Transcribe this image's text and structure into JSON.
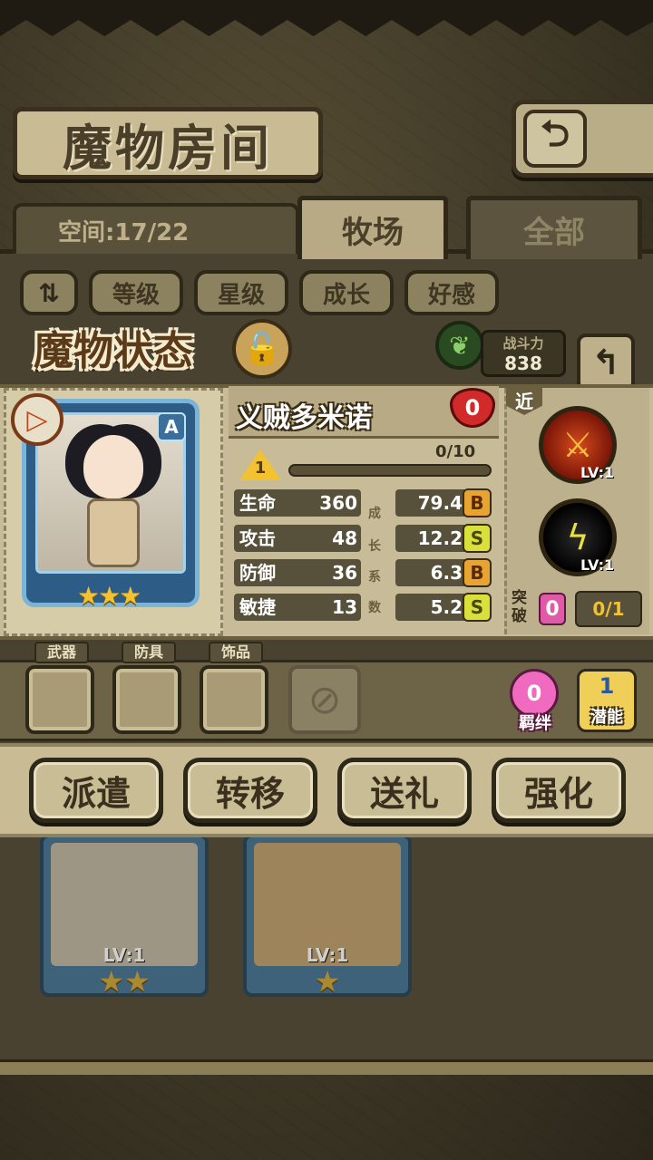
{
  "header": {
    "title": "魔物房间",
    "back_icon": "return-arrow-icon"
  },
  "room": {
    "capacity_label": "空间:17/22",
    "tabs": [
      {
        "label": "牧场",
        "active": true
      },
      {
        "label": "全部",
        "active": false
      }
    ],
    "sort_buttons": [
      "等级",
      "星级",
      "成长",
      "好感"
    ]
  },
  "status": {
    "title": "魔物状态",
    "power_label": "战斗力",
    "power_value": "838"
  },
  "monster": {
    "name": "义贼多米诺",
    "affection": "0",
    "rank": "A",
    "type_symbol": "▷",
    "stars": "★★★",
    "level": "1",
    "exp_text": "0/10",
    "exp_fraction": 0.0,
    "growth_caption": [
      "成",
      "长",
      "系",
      "数"
    ],
    "stats": [
      {
        "label": "生命",
        "value": "360",
        "growth": "79.4",
        "grade": "B"
      },
      {
        "label": "攻击",
        "value": "48",
        "growth": "12.2",
        "grade": "S"
      },
      {
        "label": "防御",
        "value": "36",
        "growth": "6.3",
        "grade": "B"
      },
      {
        "label": "敏捷",
        "value": "13",
        "growth": "5.2",
        "grade": "S"
      }
    ]
  },
  "skills": {
    "range_tag": "近",
    "items": [
      {
        "icon": "crossed-swords-icon",
        "level": "LV:1"
      },
      {
        "icon": "lightning-icon",
        "level": "LV:1"
      }
    ],
    "break_label": "突破",
    "break_count": "0",
    "break_progress": "0/1"
  },
  "equipment": {
    "slots": [
      "武器",
      "防具",
      "饰品"
    ],
    "bond_count": "0",
    "bond_label": "羁绊",
    "potential_count": "1",
    "potential_label": "潜能"
  },
  "actions": [
    "派遣",
    "转移",
    "送礼",
    "强化"
  ],
  "background_cards": [
    {
      "level": "LV:1",
      "stars": "★★"
    },
    {
      "level": "LV:1",
      "stars": "★"
    }
  ]
}
